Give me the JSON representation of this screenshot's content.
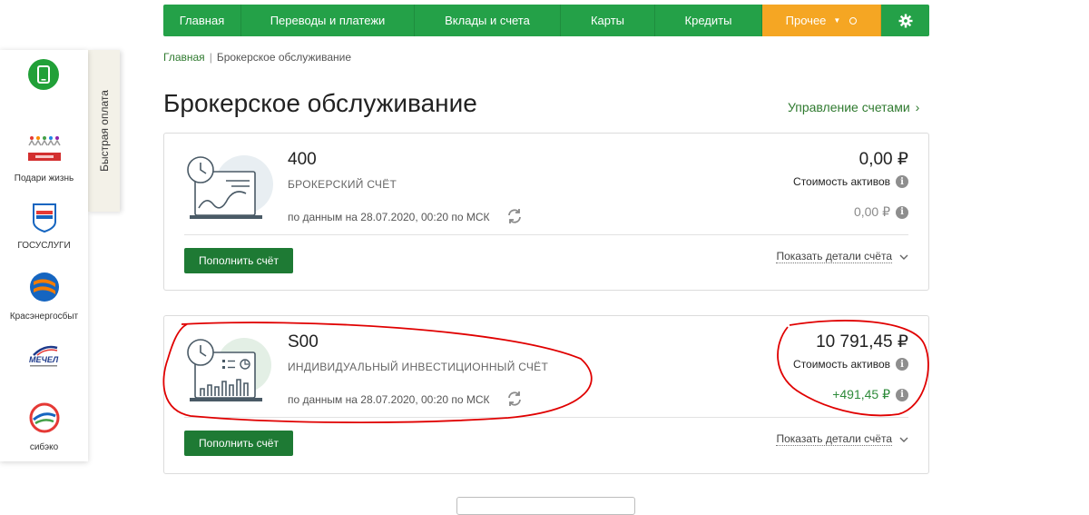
{
  "nav": {
    "items": [
      "Главная",
      "Переводы и платежи",
      "Вклады и счета",
      "Карты",
      "Кредиты",
      "Прочее"
    ]
  },
  "sidebar": {
    "tab_label": "Быстрая оплата",
    "items": [
      "Подари жизнь",
      "ГОСУСЛУГИ",
      "Красэнергосбыт",
      "сибэко"
    ]
  },
  "breadcrumb": {
    "home": "Главная",
    "current": "Брокерское обслуживание"
  },
  "page_title": "Брокерское обслуживание",
  "manage_link": "Управление счетами",
  "accounts": [
    {
      "number": "400",
      "type": "БРОКЕРСКИЙ СЧЁТ",
      "date": "по данным на 28.07.2020, 00:20 по МСК",
      "amount": "0,00 ₽",
      "assets_label": "Стоимость активов",
      "change": "0,00 ₽",
      "topup": "Пополнить счёт",
      "details": "Показать детали счёта"
    },
    {
      "number": "S00",
      "type": "ИНДИВИДУАЛЬНЫЙ ИНВЕСТИЦИОННЫЙ СЧЁТ",
      "date": "по данным на 28.07.2020, 00:20 по МСК",
      "amount": "10 791,45 ₽",
      "assets_label": "Стоимость активов",
      "change": "+491,45 ₽",
      "topup": "Пополнить счёт",
      "details": "Показать детали счёта"
    }
  ],
  "colors": {
    "brand_green": "#24a148",
    "accent_orange": "#f5a623",
    "link_green": "#2f7a2f",
    "annotation_red": "#e00000"
  }
}
